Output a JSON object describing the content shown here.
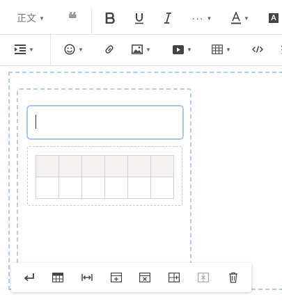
{
  "toolbar": {
    "paragraph_style": "正文",
    "background_color_glyph": "A"
  },
  "editor": {
    "table": {
      "columns": 6,
      "rows": 2
    }
  },
  "colors": {
    "selection_border": "#a9c5ee",
    "dashed_border": "#b9cde9",
    "header_cell": "#f3f0ef"
  }
}
